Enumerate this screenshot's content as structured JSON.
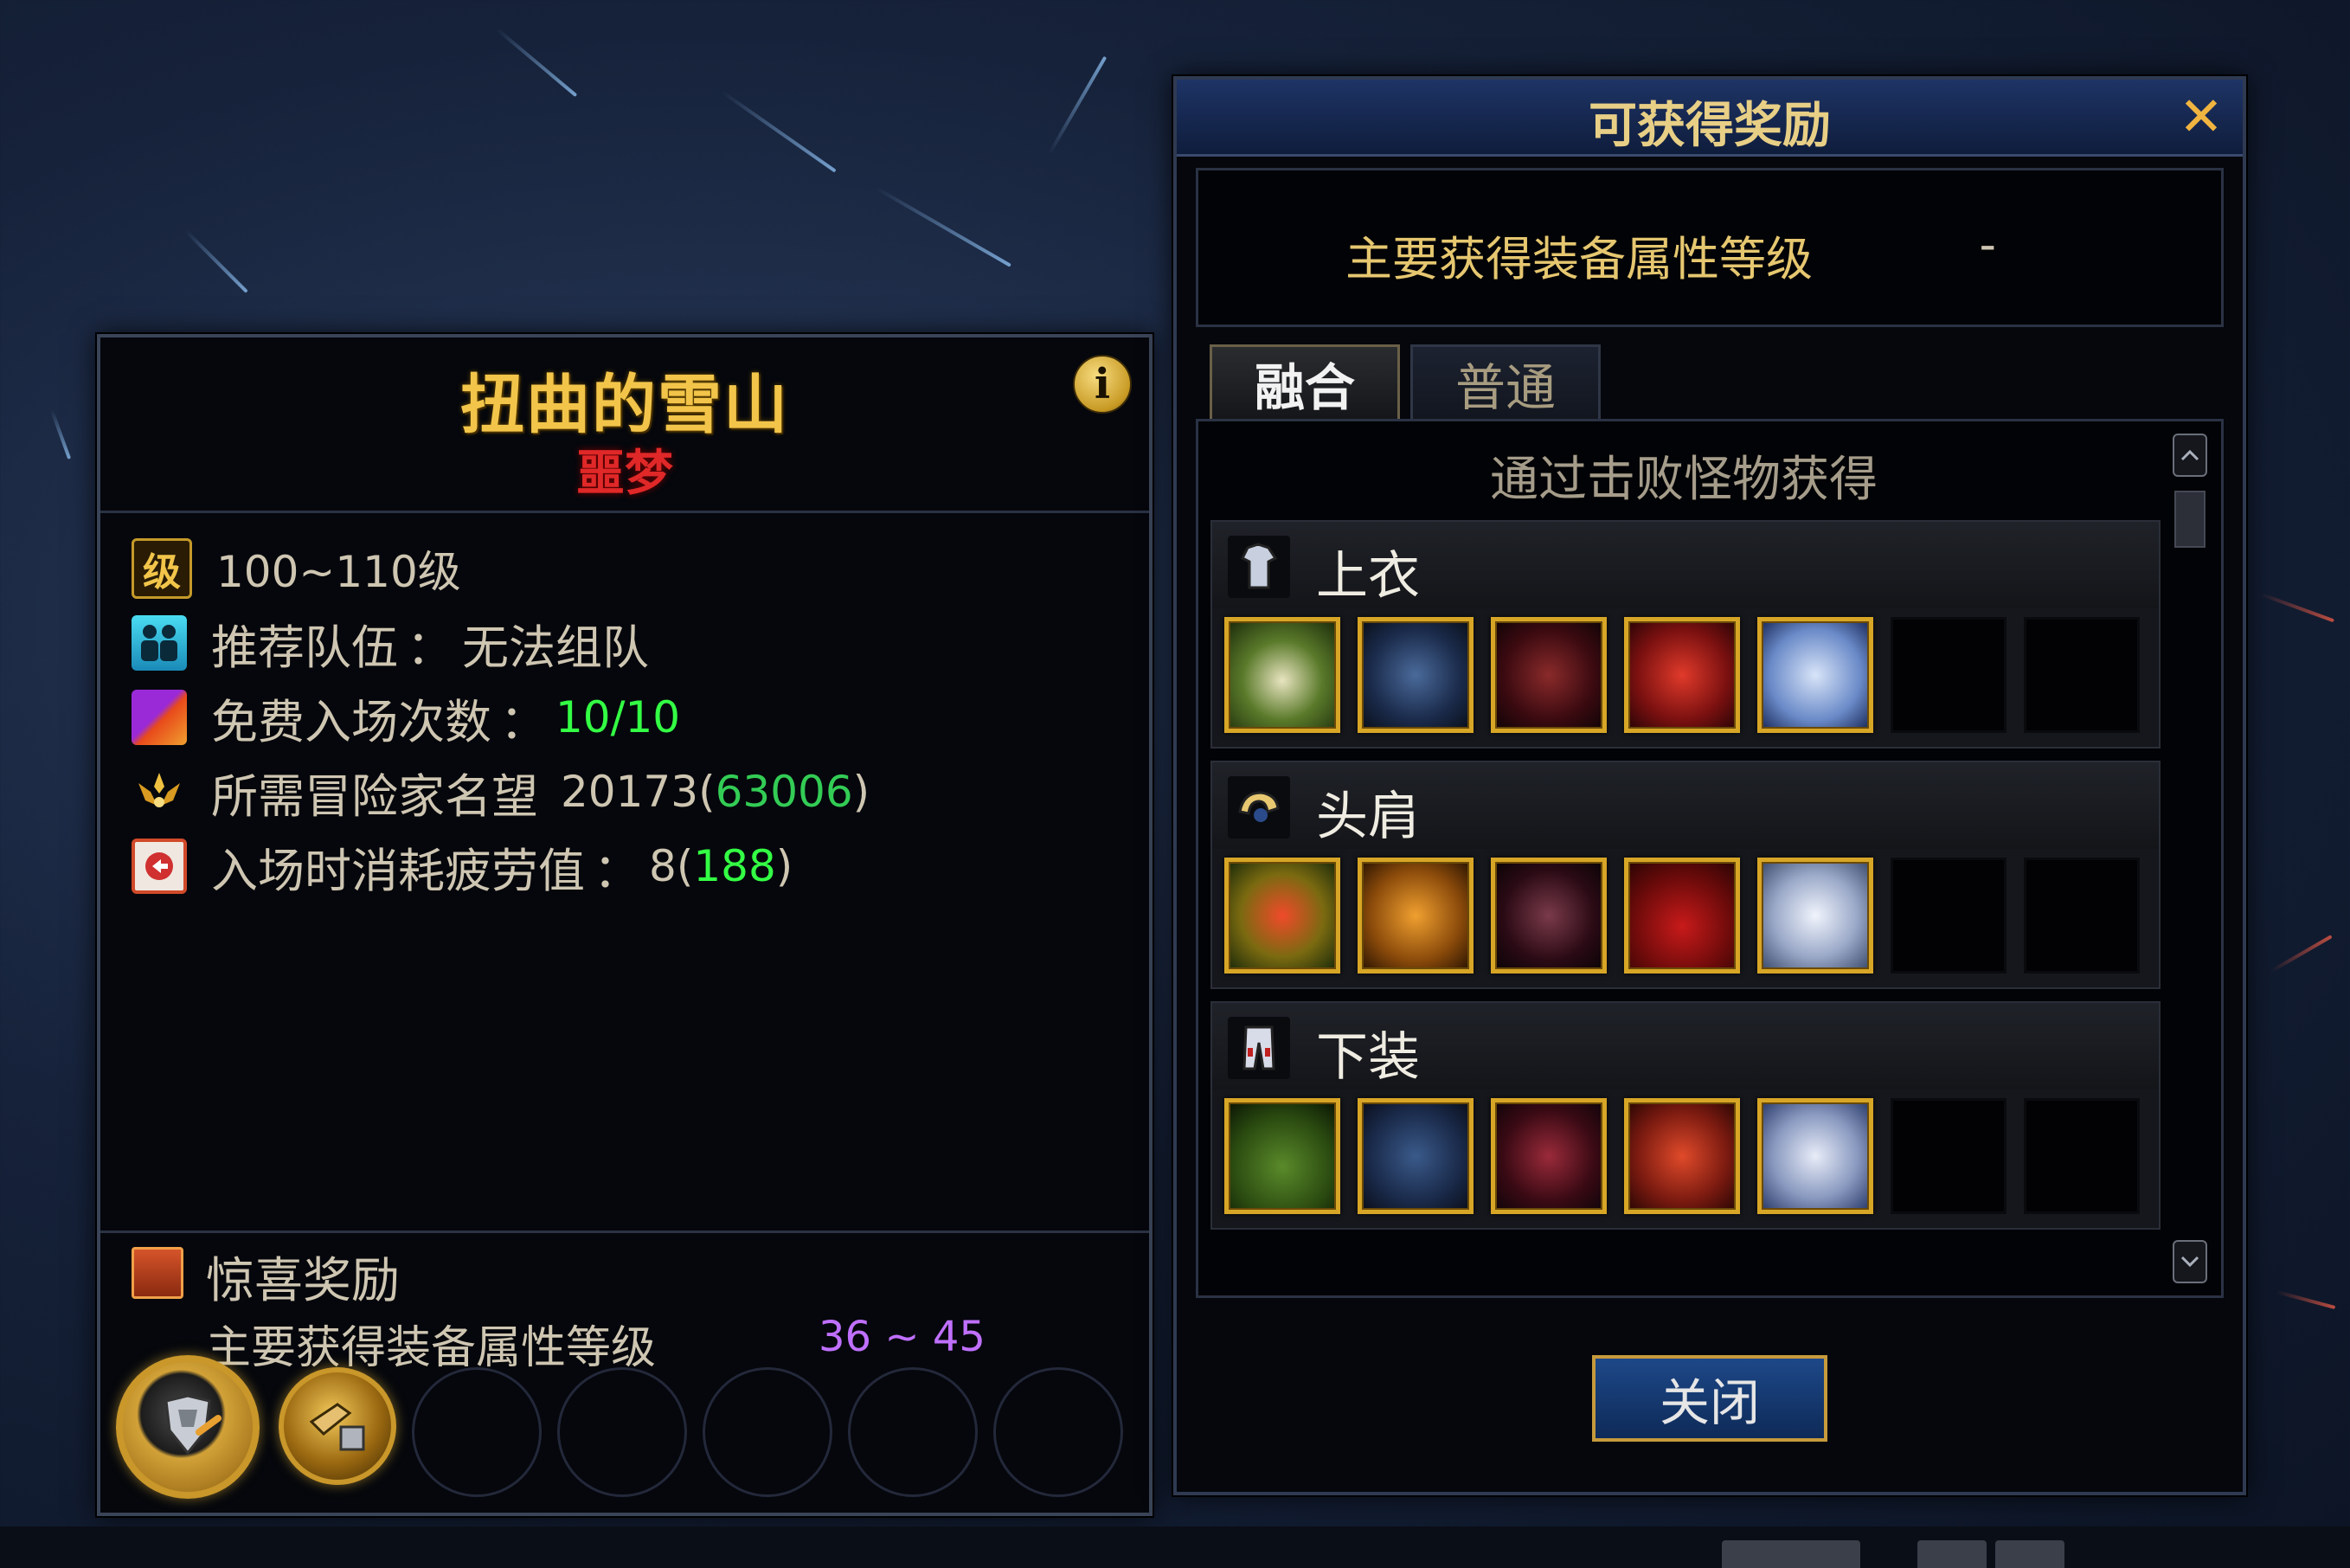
{
  "dungeon": {
    "title": "扭曲的雪山",
    "difficulty": "噩梦",
    "info_symbol": "i",
    "rows": {
      "level": {
        "icon": "level-icon",
        "icon_char": "级",
        "value": "100~110级"
      },
      "party": {
        "icon": "party-icon",
        "label": "推荐队伍",
        "sep": "：",
        "value": "无法组队"
      },
      "entries": {
        "icon": "ticket-icon",
        "label": "免费入场次数",
        "sep": "：",
        "value": "10/10"
      },
      "reputation": {
        "icon": "reputation-icon",
        "label": "所需冒险家名望",
        "value": "20173",
        "current_open": "(",
        "current": "63006",
        "current_close": ")"
      },
      "fatigue": {
        "icon": "fatigue-icon",
        "label": "入场时消耗疲劳值",
        "sep": "：",
        "value": "8",
        "current_open": "(",
        "current": "188",
        "current_close": ")"
      }
    },
    "surprise": {
      "title": "惊喜奖励",
      "attr_label": "主要获得装备属性等级",
      "attr_range": "36 ~ 45",
      "slots": [
        {
          "icon": "armor-bundle-icon",
          "filled": true
        },
        {
          "icon": "material-box-icon",
          "filled": true
        },
        {
          "filled": false
        },
        {
          "filled": false
        },
        {
          "filled": false
        },
        {
          "filled": false
        },
        {
          "filled": false
        }
      ]
    }
  },
  "rewards": {
    "title": "可获得奖励",
    "close_symbol": "✕",
    "attr_label": "主要获得装备属性等级",
    "attr_value": "-",
    "tabs": [
      {
        "label": "融合",
        "active": true
      },
      {
        "label": "普通",
        "active": false
      }
    ],
    "subtitle": "通过击败怪物获得",
    "groups": [
      {
        "label": "上衣",
        "icon": "top-armor-icon",
        "icon_char": "👕"
      },
      {
        "label": "头肩",
        "icon": "shoulder-armor-icon",
        "icon_char": "🛡"
      },
      {
        "label": "下装",
        "icon": "pants-armor-icon",
        "icon_char": "👖"
      }
    ],
    "close_button": "关闭"
  },
  "colors": {
    "gold": "#f2c54a",
    "nightmare_red": "#e02828",
    "green": "#33ff44",
    "purple": "#c070ff",
    "panel_bg": "#05070c"
  }
}
